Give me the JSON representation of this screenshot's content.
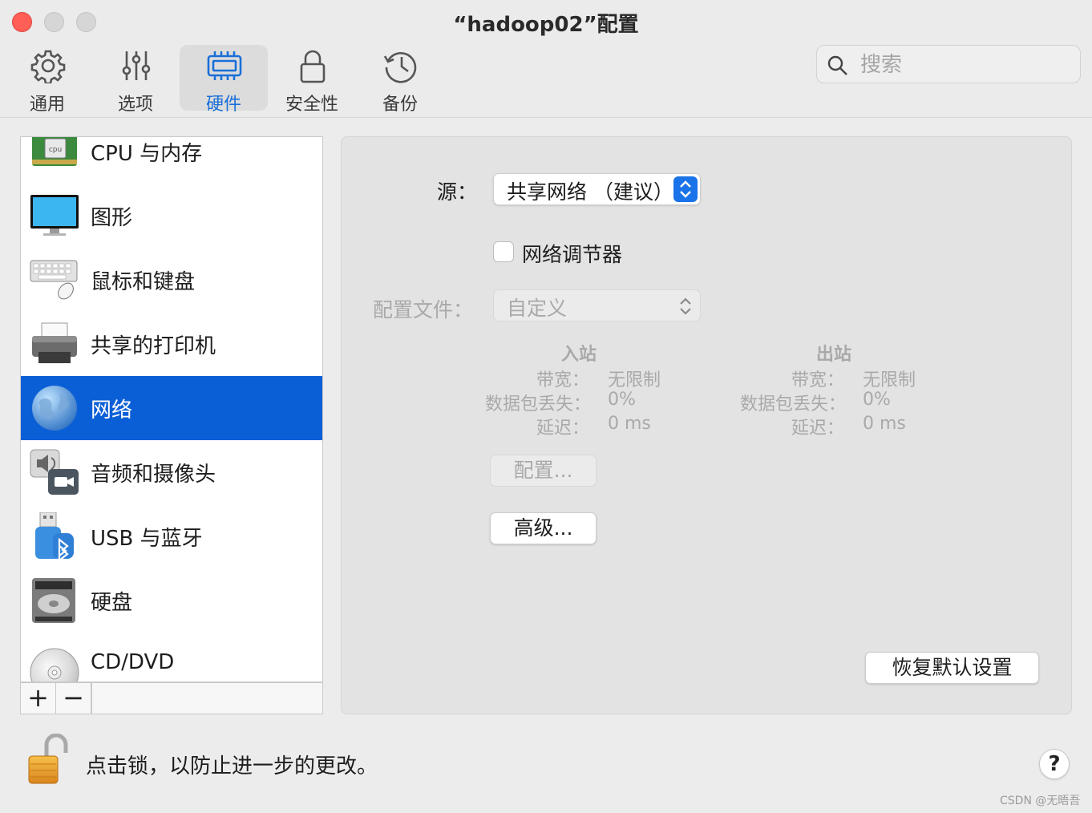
{
  "window": {
    "title": "“hadoop02”配置"
  },
  "toolbar": {
    "tabs": [
      {
        "label": "通用",
        "icon": "gear-icon"
      },
      {
        "label": "选项",
        "icon": "sliders-icon"
      },
      {
        "label": "硬件",
        "icon": "chip-icon",
        "active": true
      },
      {
        "label": "安全性",
        "icon": "lock-icon"
      },
      {
        "label": "备份",
        "icon": "history-icon"
      }
    ],
    "search": {
      "placeholder": "搜索",
      "value": ""
    }
  },
  "sidebar": {
    "items": [
      {
        "label": "CPU 与内存",
        "icon": "cpu-icon"
      },
      {
        "label": "图形",
        "icon": "monitor-icon"
      },
      {
        "label": "鼠标和键盘",
        "icon": "keyboard-mouse-icon"
      },
      {
        "label": "共享的打印机",
        "icon": "printer-icon"
      },
      {
        "label": "网络",
        "icon": "globe-icon",
        "selected": true
      },
      {
        "label": "音频和摄像头",
        "icon": "speaker-camera-icon"
      },
      {
        "label": "USB 与蓝牙",
        "icon": "usb-bluetooth-icon"
      },
      {
        "label": "硬盘",
        "icon": "hard-disk-icon"
      },
      {
        "label": "CD/DVD",
        "icon": "disc-icon"
      }
    ],
    "add_label": "+",
    "remove_label": "−"
  },
  "network": {
    "source_label": "源：",
    "source_value": "共享网络 （建议）",
    "conditioner_label": "网络调节器",
    "conditioner_checked": false,
    "profile_label": "配置文件：",
    "profile_value": "自定义",
    "inbound": {
      "header": "入站",
      "rows": [
        {
          "key": "带宽：",
          "value": "无限制"
        },
        {
          "key": "数据包丢失：",
          "value": "0%"
        },
        {
          "key": "延迟：",
          "value": "0 ms"
        }
      ]
    },
    "outbound": {
      "header": "出站",
      "rows": [
        {
          "key": "带宽：",
          "value": "无限制"
        },
        {
          "key": "数据包丢失：",
          "value": "0%"
        },
        {
          "key": "延迟：",
          "value": "0 ms"
        }
      ]
    },
    "configure_button": "配置...",
    "advanced_button": "高级...",
    "restore_button": "恢复默认设置"
  },
  "footer": {
    "lock_text": "点击锁，以防止进一步的更改。",
    "help_label": "?",
    "watermark": "CSDN @无晤吾"
  },
  "colors": {
    "accent": "#0b5fd6",
    "close": "#ff5f57",
    "active_tab_text": "#1a6fd8"
  }
}
